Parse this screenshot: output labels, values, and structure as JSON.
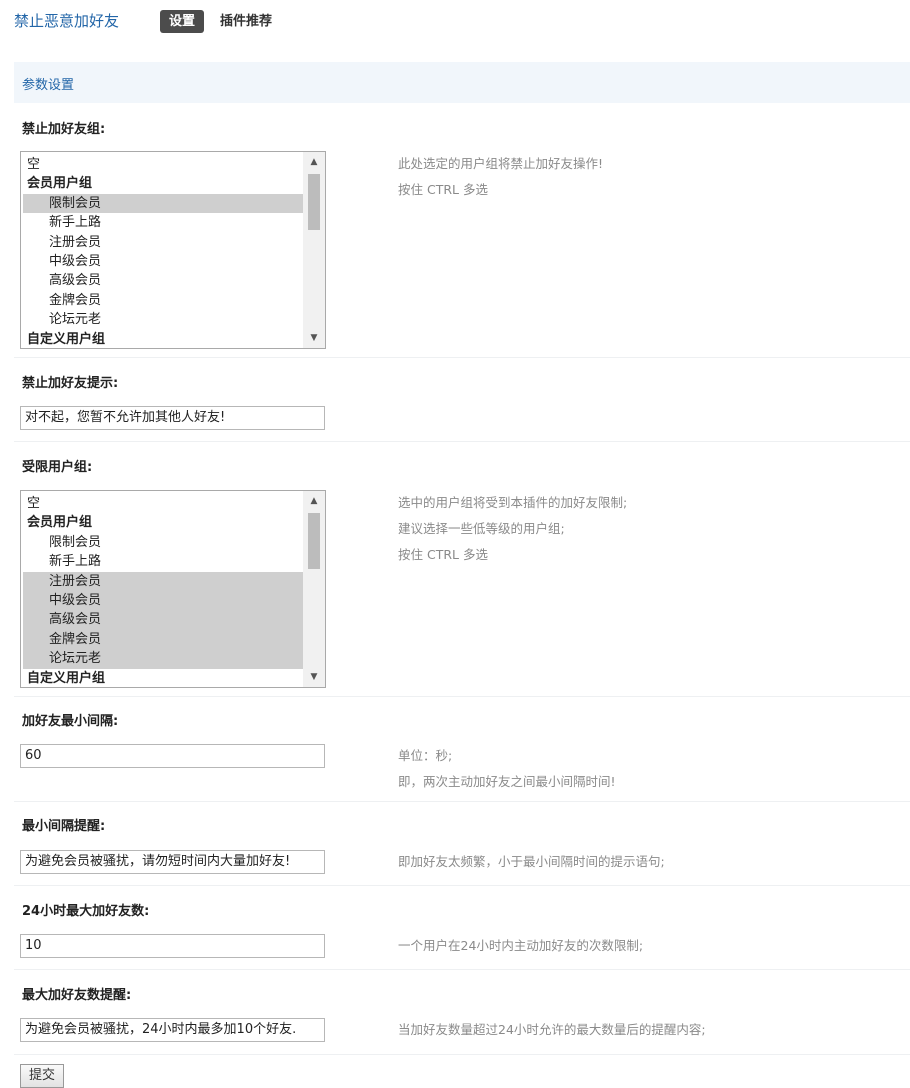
{
  "header": {
    "plugin_title": "禁止恶意加好友",
    "active_tab": "设置",
    "other_tab": "插件推荐"
  },
  "section": {
    "title": "参数设置"
  },
  "fields": {
    "ban_group": {
      "label": "禁止加好友组:",
      "options": [
        {
          "text": "空",
          "type": "option",
          "selected": false
        },
        {
          "text": "会员用户组",
          "type": "group",
          "selected": false
        },
        {
          "text": "限制会员",
          "type": "indent",
          "selected": true
        },
        {
          "text": "新手上路",
          "type": "indent",
          "selected": false
        },
        {
          "text": "注册会员",
          "type": "indent",
          "selected": false
        },
        {
          "text": "中级会员",
          "type": "indent",
          "selected": false
        },
        {
          "text": "高级会员",
          "type": "indent",
          "selected": false
        },
        {
          "text": "金牌会员",
          "type": "indent",
          "selected": false
        },
        {
          "text": "论坛元老",
          "type": "indent",
          "selected": false
        },
        {
          "text": "自定义用户组",
          "type": "group",
          "selected": false
        }
      ],
      "tip": [
        "此处选定的用户组将禁止加好友操作!",
        "按住 CTRL 多选"
      ]
    },
    "ban_msg": {
      "label": "禁止加好友提示:",
      "value": "对不起，您暂不允许加其他人好友!"
    },
    "limit_group": {
      "label": "受限用户组:",
      "options": [
        {
          "text": "空",
          "type": "option",
          "selected": false
        },
        {
          "text": "会员用户组",
          "type": "group",
          "selected": false
        },
        {
          "text": "限制会员",
          "type": "indent",
          "selected": false
        },
        {
          "text": "新手上路",
          "type": "indent",
          "selected": false
        },
        {
          "text": "注册会员",
          "type": "indent",
          "selected": true
        },
        {
          "text": "中级会员",
          "type": "indent",
          "selected": true
        },
        {
          "text": "高级会员",
          "type": "indent",
          "selected": true
        },
        {
          "text": "金牌会员",
          "type": "indent",
          "selected": true
        },
        {
          "text": "论坛元老",
          "type": "indent",
          "selected": true
        },
        {
          "text": "自定义用户组",
          "type": "group",
          "selected": false
        }
      ],
      "tip": [
        "选中的用户组将受到本插件的加好友限制;",
        "建议选择一些低等级的用户组;",
        "按住 CTRL 多选"
      ]
    },
    "min_interval": {
      "label": "加好友最小间隔:",
      "value": "60",
      "tip": [
        "单位：秒;",
        "即，两次主动加好友之间最小间隔时间!"
      ]
    },
    "interval_msg": {
      "label": "最小间隔提醒:",
      "value": "为避免会员被骚扰，请勿短时间内大量加好友!",
      "tip": [
        "即加好友太频繁，小于最小间隔时间的提示语句;"
      ]
    },
    "max_daily": {
      "label": "24小时最大加好友数:",
      "value": "10",
      "tip": [
        "一个用户在24小时内主动加好友的次数限制;"
      ]
    },
    "max_msg": {
      "label": "最大加好友数提醒:",
      "value": "为避免会员被骚扰，24小时内最多加10个好友.",
      "tip": [
        "当加好友数量超过24小时允许的最大数量后的提醒内容;"
      ]
    }
  },
  "submit_label": "提交"
}
